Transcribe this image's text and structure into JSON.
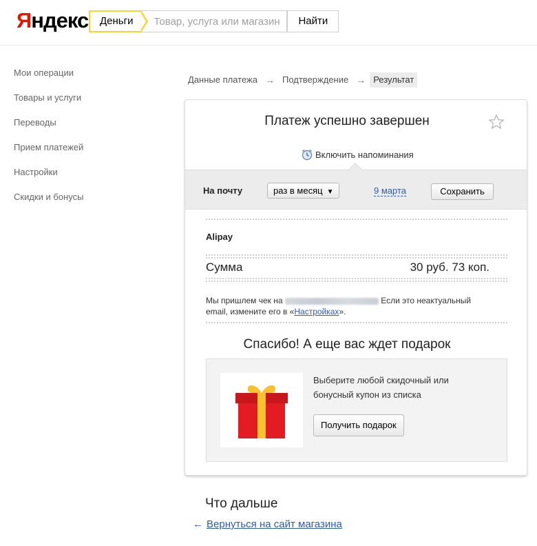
{
  "header": {
    "logo_first": "Я",
    "logo_rest": "ндекс",
    "service_tab": "Деньги",
    "search_placeholder": "Товар, услуга или магазин",
    "search_button": "Найти"
  },
  "sidebar": {
    "items": [
      {
        "label": "Мои операции"
      },
      {
        "label": "Товары и услуги"
      },
      {
        "label": "Переводы"
      },
      {
        "label": "Прием платежей"
      },
      {
        "label": "Настройки"
      },
      {
        "label": "Скидки и бонусы"
      }
    ]
  },
  "breadcrumbs": {
    "items": [
      "Данные платежа",
      "Подтверждение",
      "Результат"
    ],
    "separator": "→"
  },
  "card": {
    "title": "Платеж успешно завершен",
    "reminder_label": "Включить напоминания",
    "reminder": {
      "to_mail_label": "На почту",
      "period_value": "раз в месяц",
      "period_arrow": "▼",
      "date": "9 марта",
      "save_label": "Сохранить"
    },
    "merchant": "Alipay",
    "sum_label": "Сумма",
    "sum_value": "30 руб. 73 коп.",
    "receipt": {
      "prefix": "Мы пришлем чек на",
      "middle": " Если это неактуальный email, измените его в «",
      "link": "Настройках",
      "suffix": "»."
    },
    "gift": {
      "title": "Спасибо! А еще вас ждет подарок",
      "text": "Выберите любой скидочный или бонусный купон из списка",
      "button": "Получить подарок"
    }
  },
  "next": {
    "title": "Что дальше",
    "back_arrow": "←",
    "back_link": "Вернуться на сайт магазина"
  },
  "colors": {
    "brand_red": "#e61400",
    "accent_yellow": "#fed42b",
    "link_blue": "#2b5bb5",
    "gift_red": "#e31b23",
    "gift_yellow": "#fbc02d"
  },
  "icons": {
    "star": "star-icon",
    "clock": "alarm-clock-icon",
    "gift": "gift-icon",
    "back": "arrow-left-icon"
  }
}
